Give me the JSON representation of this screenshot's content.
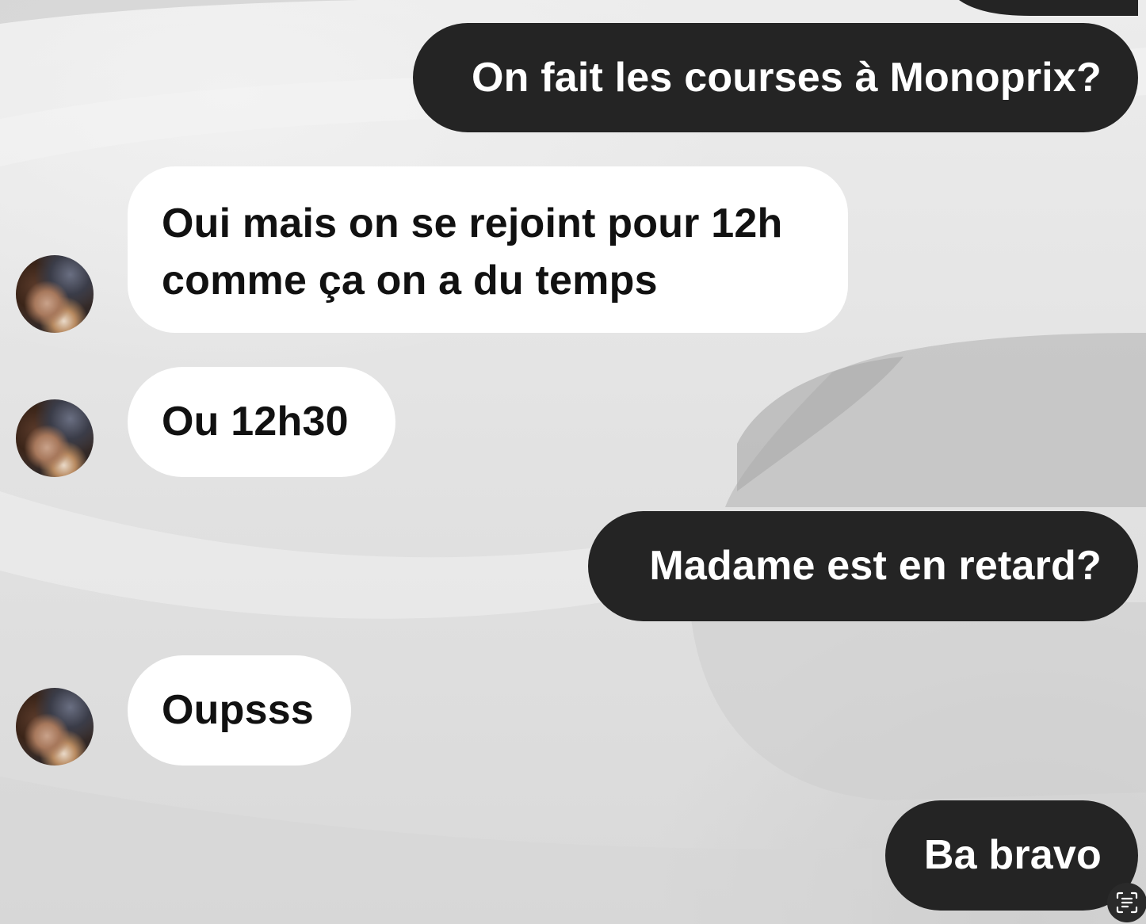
{
  "conversation": {
    "messages": [
      {
        "direction": "outgoing",
        "text": "On fait les courses à Monoprix?"
      },
      {
        "direction": "incoming",
        "lines": [
          "Oui mais on se rejoint pour 12h",
          "comme ça on a du temps"
        ]
      },
      {
        "direction": "incoming",
        "text": "Ou 12h30"
      },
      {
        "direction": "outgoing",
        "text": "Madame est en retard?"
      },
      {
        "direction": "incoming",
        "text": "Oupsss"
      },
      {
        "direction": "outgoing",
        "text": "Ba bravo"
      }
    ]
  },
  "icons": {
    "avatar": "contact-avatar",
    "live_text": "text-scan-icon"
  },
  "colors": {
    "outgoing_bubble": "#242424",
    "incoming_bubble": "#ffffff",
    "background": "#e6e6e6"
  }
}
